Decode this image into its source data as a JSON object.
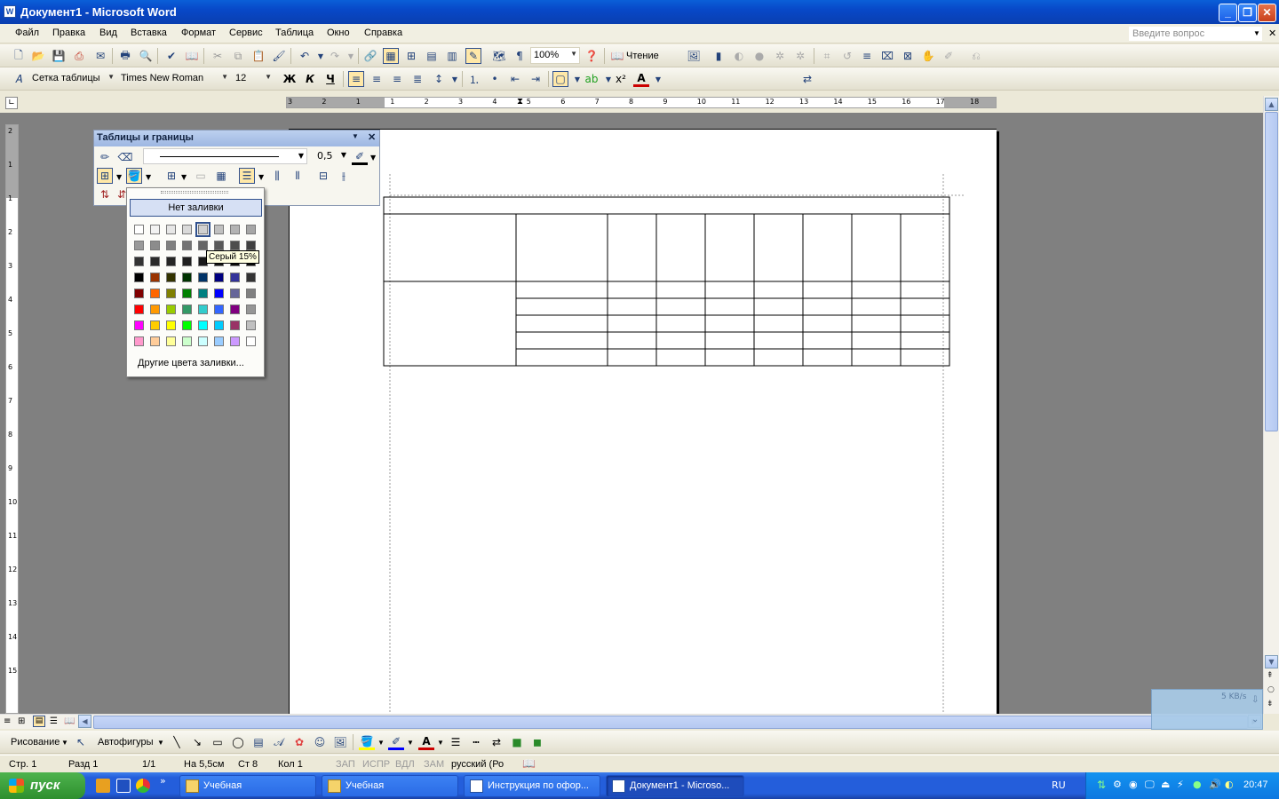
{
  "window": {
    "title": "Документ1 - Microsoft Word",
    "app_icon": "W",
    "min_label": "_",
    "max_label": "❐",
    "close_label": "✕"
  },
  "menubar": {
    "items": [
      "Файл",
      "Правка",
      "Вид",
      "Вставка",
      "Формат",
      "Сервис",
      "Таблица",
      "Окно",
      "Справка"
    ],
    "ask_placeholder": "Введите вопрос",
    "close_doc": "✕"
  },
  "standard_toolbar": {
    "zoom": "100%",
    "read_label": "Чтение"
  },
  "formatting_toolbar": {
    "style": "Сетка таблицы",
    "font": "Times New Roman",
    "size": "12",
    "bold": "Ж",
    "italic": "К",
    "underline": "Ч"
  },
  "ruler": {
    "h_labels": [
      "3",
      "2",
      "1",
      "1",
      "2",
      "3",
      "4",
      "5",
      "6",
      "7",
      "8",
      "9",
      "10",
      "11",
      "12",
      "13",
      "14",
      "15",
      "16",
      "17",
      "18"
    ],
    "v_labels": [
      "2",
      "1",
      "1",
      "2",
      "3",
      "4",
      "5",
      "6",
      "7",
      "8",
      "9",
      "10",
      "11",
      "12",
      "13",
      "14",
      "15"
    ]
  },
  "tables_toolbar": {
    "title": "Таблицы и границы",
    "line_weight": "0,5"
  },
  "shading_menu": {
    "no_fill": "Нет заливки",
    "more_colors": "Другие цвета заливки...",
    "tooltip": "Серый 15%",
    "swatches": [
      [
        "#ffffff",
        "#f2f2f2",
        "#e6e6e6",
        "#d9d9d9",
        "#d0d0d0",
        "#c0c0c0",
        "#b3b3b3",
        "#a6a6a6"
      ],
      [
        "#999999",
        "#8c8c8c",
        "#808080",
        "#737373",
        "#666666",
        "#595959",
        "#4d4d4d",
        "#404040"
      ],
      [
        "#333333",
        "#2b2b2b",
        "#262626",
        "#202020",
        "#1a1a1a",
        "#141414",
        "#0d0d0d",
        "#080808"
      ],
      [
        "#000000",
        "#993300",
        "#333300",
        "#003300",
        "#003366",
        "#000080",
        "#333399",
        "#333333"
      ],
      [
        "#800000",
        "#ff6600",
        "#808000",
        "#008000",
        "#008080",
        "#0000ff",
        "#666699",
        "#808080"
      ],
      [
        "#ff0000",
        "#ff9900",
        "#99cc00",
        "#339966",
        "#33cccc",
        "#3366ff",
        "#800080",
        "#969696"
      ],
      [
        "#ff00ff",
        "#ffcc00",
        "#ffff00",
        "#00ff00",
        "#00ffff",
        "#00ccff",
        "#993366",
        "#c0c0c0"
      ],
      [
        "#ff99cc",
        "#ffcc99",
        "#ffff99",
        "#ccffcc",
        "#ccffff",
        "#99ccff",
        "#cc99ff",
        "#ffffff"
      ]
    ]
  },
  "drawing_toolbar": {
    "draw_label": "Рисование",
    "autoshapes_label": "Автофигуры"
  },
  "statusbar": {
    "page": "Стр. 1",
    "section": "Разд 1",
    "pages": "1/1",
    "at": "На 5,5см",
    "line": "Ст 8",
    "col": "Кол 1",
    "rec": "ЗАП",
    "trk": "ИСПР",
    "ext": "ВДЛ",
    "ovr": "ЗАМ",
    "lang": "русский (Ро"
  },
  "taskbar": {
    "start_label": "пуск",
    "tasks": [
      "Учебная",
      "Учебная",
      "Инструкция по офор...",
      "Документ1 - Microso..."
    ],
    "lang": "RU",
    "clock": "20:47"
  },
  "net_widget": {
    "speed": "5 KB/s"
  },
  "colors": {
    "title_bar": "#0848c8",
    "workspace": "#808080",
    "taskbar": "#245edb",
    "start": "#2d8f2d",
    "accent_selection": "#31518e"
  }
}
